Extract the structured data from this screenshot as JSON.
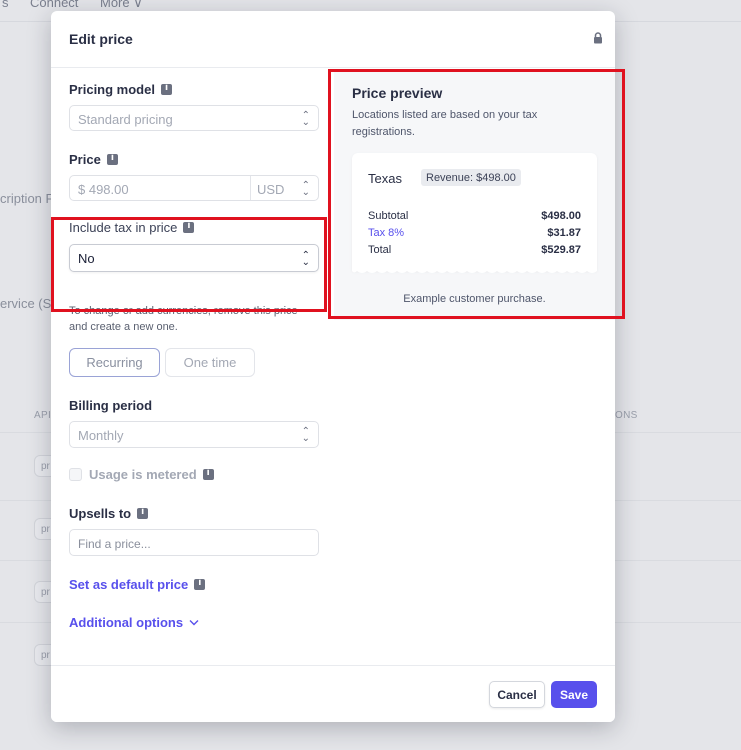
{
  "background": {
    "nav_items": [
      "s",
      "Connect",
      "More ∨"
    ],
    "left_fragments": [
      "cription F",
      "ervice (S"
    ],
    "col_left": "API",
    "col_right": "ONS",
    "row_pill": "pr"
  },
  "modal": {
    "title": "Edit price",
    "pricing_model": {
      "label": "Pricing model",
      "value": "Standard pricing"
    },
    "price": {
      "label": "Price",
      "value": "$ 498.00",
      "currency": "USD"
    },
    "include_tax": {
      "label": "Include tax in price",
      "value": "No"
    },
    "help_text": "To change or add currencies, remove this price and create a new one.",
    "type_tabs": {
      "recurring": "Recurring",
      "one_time": "One time"
    },
    "billing_period": {
      "label": "Billing period",
      "value": "Monthly"
    },
    "usage_metered": "Usage is metered",
    "upsells": {
      "label": "Upsells to",
      "placeholder": "Find a price..."
    },
    "set_default": "Set as default price",
    "additional_options": "Additional options",
    "cancel": "Cancel",
    "save": "Save"
  },
  "preview": {
    "title": "Price preview",
    "subtitle": "Locations listed are based on your tax registrations.",
    "location": "Texas",
    "revenue_badge": "Revenue: $498.00",
    "subtotal_label": "Subtotal",
    "subtotal_value": "$498.00",
    "tax_label": "Tax 8%",
    "tax_value": "$31.87",
    "total_label": "Total",
    "total_value": "$529.87",
    "note": "Example customer purchase."
  },
  "colors": {
    "accent": "#5850ec",
    "highlight": "#e0111f"
  }
}
